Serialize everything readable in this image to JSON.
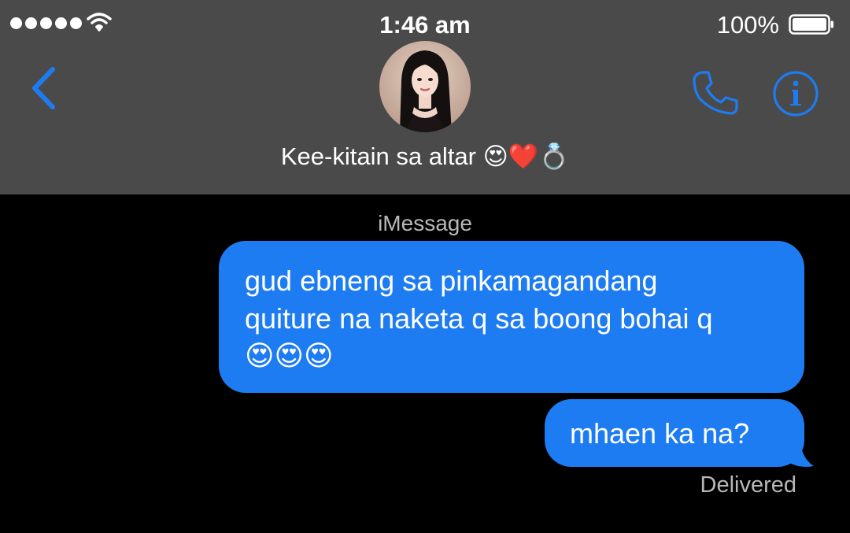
{
  "status_bar": {
    "time": "1:46 am",
    "battery_percent": "100%",
    "signal_bars": 5,
    "icons": [
      "signal-dots-icon",
      "wifi-icon",
      "battery-icon"
    ]
  },
  "nav": {
    "icons": [
      "back-chevron-icon",
      "phone-icon",
      "info-icon"
    ],
    "contact_name": "Kee-kitain sa altar 😍❤️💍"
  },
  "conversation": {
    "service_label": "iMessage",
    "messages": [
      {
        "line1": "gud ebneng sa pinkamagandang",
        "line2": "quiture na naketa q sa boong bohai q",
        "emojis": "😍😍😍"
      },
      {
        "text": "mhaen ka na?"
      }
    ],
    "delivery_status": "Delivered"
  },
  "colors": {
    "header_bg": "#4a4a4a",
    "background": "#000000",
    "accent_blue": "#1e7cf2",
    "bubble_blue": "#1e7cf2",
    "secondary_text": "#b8b8b8"
  }
}
